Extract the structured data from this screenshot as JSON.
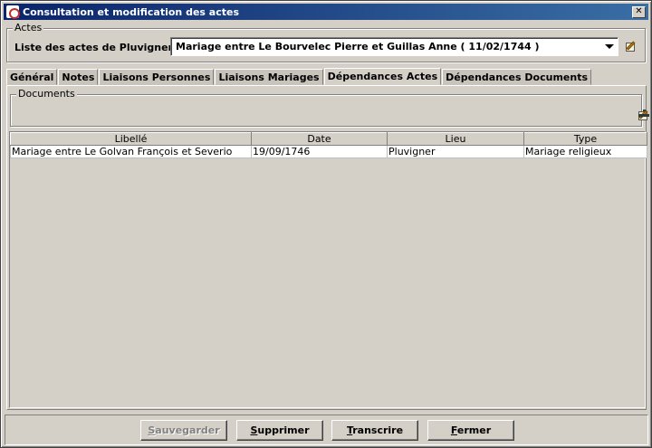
{
  "window": {
    "title": "Consultation et modification des actes",
    "close_glyph": "✕"
  },
  "actes": {
    "legend": "Actes",
    "label": "Liste des actes de Pluvigner:",
    "selected": "Mariage entre Le Bourvelec Pierre et Guillas Anne ( 11/02/1744 )"
  },
  "tabs": [
    {
      "label": "Général"
    },
    {
      "label": "Notes"
    },
    {
      "label": "Liaisons Personnes"
    },
    {
      "label": "Liaisons Mariages"
    },
    {
      "label": "Dépendances Actes"
    },
    {
      "label": "Dépendances Documents"
    }
  ],
  "active_tab": "Dépendances Actes",
  "documents": {
    "legend": "Documents"
  },
  "table": {
    "columns": [
      "Libellé",
      "Date",
      "Lieu",
      "Type"
    ],
    "rows": [
      [
        "Mariage entre Le Golvan François et Severio",
        "19/09/1746",
        "Pluvigner",
        "Mariage religieux"
      ]
    ]
  },
  "buttons": {
    "save": {
      "first": "S",
      "rest": "auvegarder"
    },
    "delete": {
      "first": "S",
      "rest": "upprimer"
    },
    "transcribe": {
      "first": "T",
      "rest": "ranscrire"
    },
    "close": {
      "first": "F",
      "rest": "ermer"
    }
  }
}
